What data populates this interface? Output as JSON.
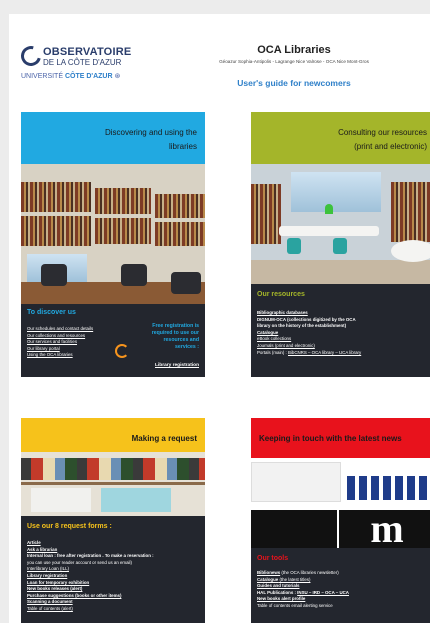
{
  "header": {
    "logo_line1": "OBSERVATOIRE",
    "logo_line2": "DE LA CÔTE D'AZUR",
    "logo_line3a": "UNIVERSITÉ ",
    "logo_line3b": "CÔTE D'AZUR",
    "title": "OCA Libraries",
    "sites": "Géoazur Sophia-Antipolis  -  Lagrange Nice Valrose  -  OCA Nice Mont-Gros",
    "guide": "User's guide for newcomers"
  },
  "cards": {
    "discover": {
      "title_l1": "Discovering  and using the",
      "title_l2": "libraries",
      "section_title": "To discover us",
      "links": [
        "Our schedules and contact details",
        "Our collections and resources",
        "Our services and facilities",
        "Our library portal",
        "Using the OCA libraries"
      ],
      "free_reg_l1": "Free registration is",
      "free_reg_l2": "required to use our",
      "free_reg_l3": "resources and",
      "free_reg_l4": "services :",
      "registration_link": "Library registration"
    },
    "consult": {
      "title_l1": "Consulting  our resources",
      "title_l2": "(print and electronic)",
      "section_title": "Our resources",
      "item1": "Bibliographic databases",
      "item2": "DIGNUM-OCA (collections digitized by the OCA",
      "item2b": "library on the history of the establishment)",
      "item3": "Catalogue",
      "item4": "eBook collections",
      "item5": "Journals (print and electronic)",
      "item6_prefix": "Portals (main)  : ",
      "item6_links": "BibCNRS – OCA library – UCA library"
    },
    "request": {
      "title": "Making a request",
      "section_title": "Use our 8 request forms :",
      "items": [
        "Article",
        "Ask a librarian",
        "Internal loan : free after registration . To make a reservation :",
        "you can use your reader account or send us an email)",
        "Interlibrary Loan (ILL)",
        "Library registration",
        "Loan for temporary exhibition",
        "New books releases (alert)",
        "Purchase suggestions (books or other items)",
        "Scanning a document",
        "Table of contents (alert)"
      ]
    },
    "news": {
      "title": "Keeping in touch with the latest news",
      "section_title": "Our tools",
      "item1a": "Biblionews",
      "item1b": " (the OCA libraries newsletter)",
      "item2a": "Catalogue",
      "item2b": " (the latest titles)",
      "item3": "Guides and tutorials",
      "item4a": "HAL Publications : ",
      "item4b": "INSU – IRD – OCA – UCA",
      "item5": "New books alert profile",
      "item6": "Table of contents email alerting service"
    }
  },
  "colors": {
    "blue": "#21a9e1",
    "olive": "#a4b52a",
    "yellow": "#f6c21b",
    "red": "#e8121c",
    "dark": "#23262e",
    "orange": "#f7941d"
  }
}
